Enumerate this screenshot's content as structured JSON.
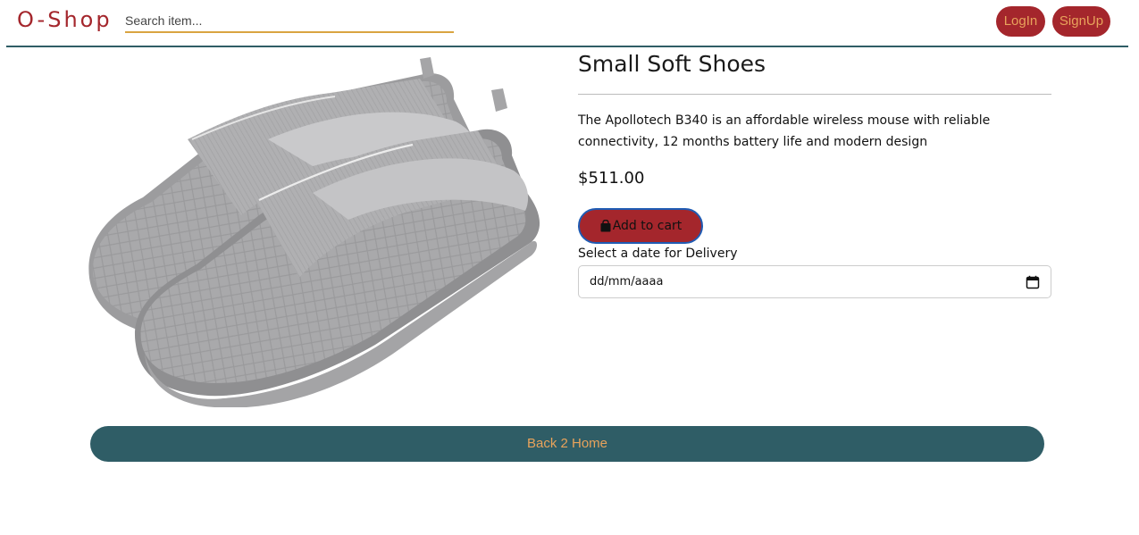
{
  "navbar": {
    "brand": "O-Shop",
    "search_placeholder": "Search item...",
    "login_label": "LogIn",
    "signup_label": "SignUp"
  },
  "product": {
    "title": "Small Soft Shoes",
    "description": "The Apollotech B340 is an affordable wireless mouse with reliable connectivity, 12 months battery life and modern design",
    "price": "$511.00",
    "add_to_cart_label": "Add to cart",
    "image_alt_icon": "shoe-image"
  },
  "delivery": {
    "label": "Select a date for Delivery",
    "date_placeholder": "dd/mm/aaaa"
  },
  "footer": {
    "back_label": "Back 2 Home"
  },
  "colors": {
    "brand_red": "#a4262c",
    "teal": "#2f5d66",
    "accent_orange": "#e8a35b",
    "search_underline": "#d9a441",
    "focus_blue": "#1f5bb3"
  }
}
